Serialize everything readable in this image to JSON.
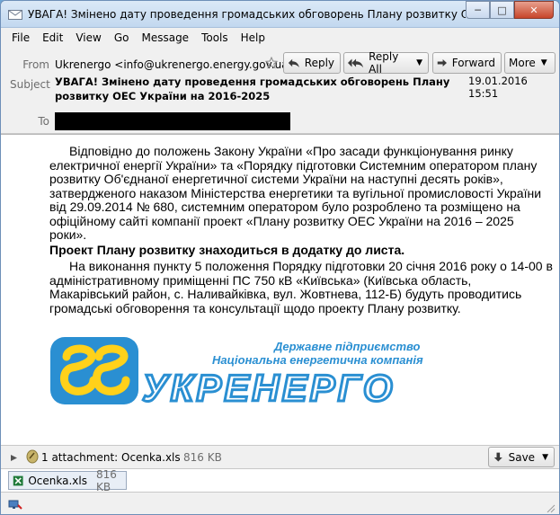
{
  "window": {
    "title": "УВАГА! Змінено дату проведення громадських обговорень Плану розвитку ОЕС Украї"
  },
  "menu": [
    "File",
    "Edit",
    "View",
    "Go",
    "Message",
    "Tools",
    "Help"
  ],
  "header": {
    "from_label": "From",
    "from_value": "Ukrenergo <info@ukrenergo.energy.gov.ua>",
    "subject_label": "Subject",
    "subject_value": "УВАГА! Змінено дату проведення громадських обговорень Плану розвитку ОЕС України на 2016-2025",
    "date": "19.01.2016 15:51",
    "to_label": "To",
    "buttons": {
      "reply": "Reply",
      "reply_all": "Reply All",
      "forward": "Forward",
      "more": "More"
    }
  },
  "body": {
    "p1": "Відповідно до положень Закону України «Про засади функціонування ринку електричної енергії України» та «Порядку підготовки Системним оператором плану розвитку Об'єднаної енергетичної системи України на наступні десять років», затвердженого наказом Міністерства енергетики та вугільної промисловості України від 29.09.2014 № 680, системним оператором було розроблено та розміщено на офіційному сайті компанії проект «Плану розвитку ОЕС України на 2016 – 2025 роки».",
    "p2": "Проект Плану розвитку знаходиться в додатку до листа.",
    "p3": "На виконання пункту 5 положення Порядку підготовки 20 січня 2016 року о 14-00 в адміністративному приміщенні ПС 750 кВ «Київська» (Київська область, Макарівський район, с. Наливайківка, вул. Жовтнева, 112-Б) будуть проводитись громадські обговорення та консультації щодо проекту Плану розвитку.",
    "logo": {
      "line1": "Державне підприємство",
      "line2": "Національна енергетична компанія",
      "word": "УКРЕНЕРГО"
    }
  },
  "attachments": {
    "summary": "1 attachment: Ocenka.xls",
    "summary_size": "816 KB",
    "save_label": "Save",
    "file_name": "Ocenka.xls",
    "file_size": "816 KB"
  }
}
